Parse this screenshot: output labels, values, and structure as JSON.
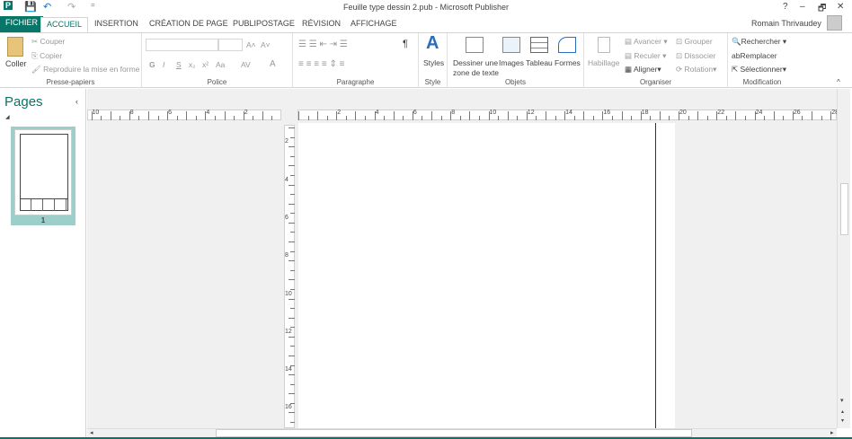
{
  "window": {
    "title": "Feuille type dessin 2.pub - Microsoft Publisher",
    "help": "?",
    "minimize": "–",
    "restore": "🗗",
    "close": "✕"
  },
  "quick_access": {
    "app_icon": "P",
    "save": "💾",
    "undo": "↶",
    "redo": "↷",
    "customize": "="
  },
  "user": {
    "name": "Romain Thrivaudey"
  },
  "tabs": [
    "FICHIER",
    "ACCUEIL",
    "INSERTION",
    "CRÉATION DE PAGE",
    "PUBLIPOSTAGE",
    "RÉVISION",
    "AFFICHAGE"
  ],
  "ribbon": {
    "clipboard": {
      "label": "Presse-papiers",
      "paste": "Coller",
      "cut": "Couper",
      "copy": "Copier",
      "format_painter": "Reproduire la mise en forme"
    },
    "font": {
      "label": "Police",
      "font_name": "",
      "font_size": "",
      "grow": "A˄",
      "shrink": "A˅",
      "bold": "G",
      "italic": "I",
      "underline": "S",
      "subscript": "x₂",
      "superscript": "x²",
      "case": "Aa",
      "spacing": "AV",
      "color": "A"
    },
    "paragraph": {
      "label": "Paragraphe",
      "pilcrow": "¶"
    },
    "style": {
      "label": "Style",
      "styles": "Styles"
    },
    "objects": {
      "label": "Objets",
      "textbox_line1": "Dessiner une",
      "textbox_line2": "zone de texte",
      "images": "Images",
      "table": "Tableau",
      "shapes": "Formes"
    },
    "arrange": {
      "label": "Organiser",
      "wrap": "Habillage",
      "forward": "Avancer",
      "backward": "Reculer",
      "align": "Aligner",
      "group": "Grouper",
      "ungroup": "Dissocier",
      "rotate": "Rotation"
    },
    "editing": {
      "label": "Modification",
      "find": "Rechercher",
      "replace": "Remplacer",
      "select": "Sélectionner"
    }
  },
  "pages_pane": {
    "title": "Pages",
    "pages": [
      {
        "number": "1"
      }
    ]
  },
  "rulers": {
    "horizontal_left": [
      "10",
      "8",
      "6",
      "4",
      "2",
      "0"
    ],
    "horizontal_right": [
      "2",
      "4",
      "6",
      "8",
      "10",
      "12",
      "14",
      "16",
      "18",
      "20",
      "22",
      "24",
      "26",
      "28"
    ],
    "vertical": [
      "2",
      "4",
      "6",
      "8",
      "10",
      "12",
      "14",
      "16"
    ]
  },
  "colors": {
    "accent": "#077568",
    "thumb_bg": "#9ccfca"
  }
}
